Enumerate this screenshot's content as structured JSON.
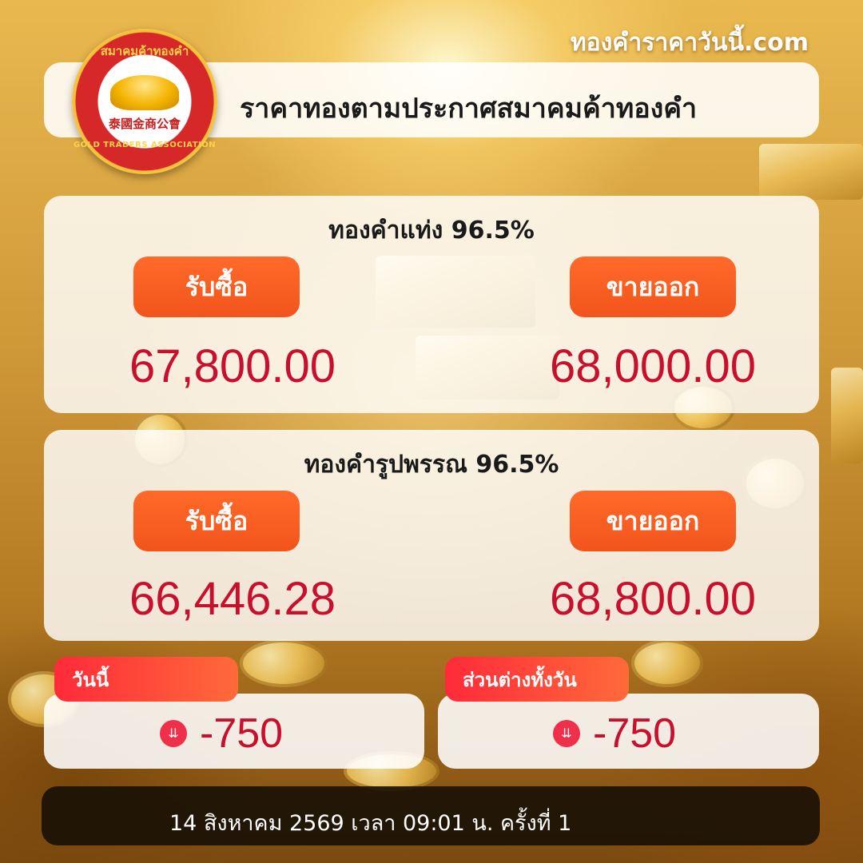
{
  "site_url": "ทองคำราคาวันนี้.com",
  "header": {
    "title": "ราคาทองตามประกาศสมาคมค้าทองคำ",
    "logo": {
      "thai_text": "สมาคมค้าทองคำ",
      "chinese_text": "泰國金商公會",
      "english_text": "GOLD TRADERS ASSOCIATION"
    }
  },
  "gold_bar": {
    "title": "ทองคำแท่ง 96.5%",
    "buy_label": "รับซื้อ",
    "sell_label": "ขายออก",
    "buy_price": "67,800.00",
    "sell_price": "68,000.00"
  },
  "gold_ornament": {
    "title": "ทองคำรูปพรรณ 96.5%",
    "buy_label": "รับซื้อ",
    "sell_label": "ขายออก",
    "buy_price": "66,446.28",
    "sell_price": "68,800.00"
  },
  "today_change": {
    "label": "วันนี้",
    "value": "-750",
    "icon": "double-chevron-down-icon"
  },
  "day_diff": {
    "label": "ส่วนต่างทั้งวัน",
    "value": "-750",
    "icon": "double-chevron-down-icon"
  },
  "footer": {
    "text": "14 สิงหาคม 2569 เวลา 09:01 น. ครั้งที่ 1"
  },
  "colors": {
    "price_red": "#c8102e",
    "pill_orange": "#f2541b",
    "tag_red": "#ff2a3a"
  }
}
